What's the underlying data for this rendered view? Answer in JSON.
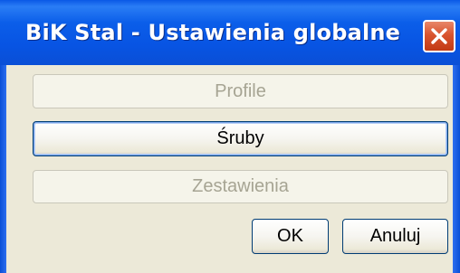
{
  "window": {
    "title": "BiK Stal - Ustawienia globalne"
  },
  "buttons": {
    "profile": "Profile",
    "sruby": "Śruby",
    "zestawienia": "Zestawienia",
    "ok": "OK",
    "cancel": "Anuluj"
  },
  "icons": {
    "close": "close-icon"
  },
  "colors": {
    "titlebar": "#0854e3",
    "close_button": "#d9542f",
    "dialog_background": "#ece9d8",
    "button_border": "#003c74",
    "disabled_text": "#a6a493"
  }
}
